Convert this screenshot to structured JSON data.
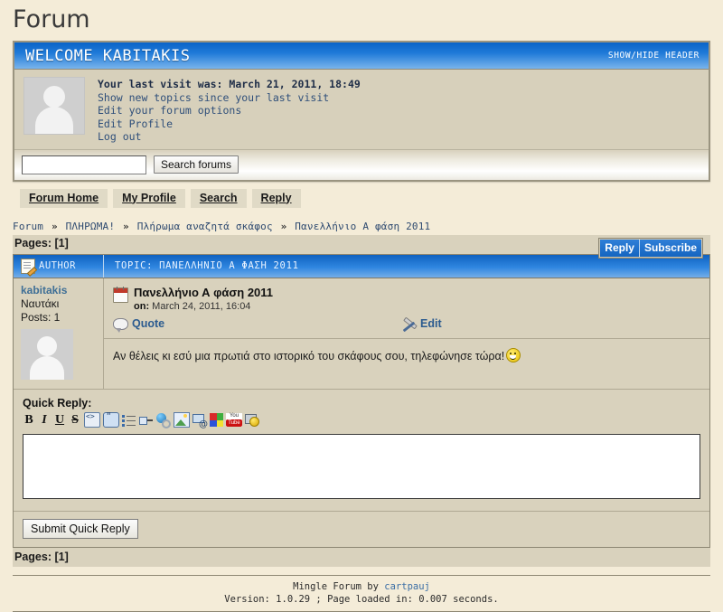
{
  "page": {
    "title": "Forum"
  },
  "welcome": {
    "title": "WELCOME KABITAKIS",
    "show_hide_header": "SHOW/HIDE HEADER",
    "last_visit": "Your last visit was: March 21, 2011, 18:49",
    "links": [
      "Show new topics since your last visit",
      "Edit your forum options",
      "Edit Profile",
      "Log out"
    ],
    "search": {
      "value": "",
      "placeholder": "",
      "button_label": "Search forums"
    }
  },
  "nav": {
    "items": [
      "Forum Home",
      "My Profile",
      "Search",
      "Reply"
    ]
  },
  "breadcrumb": {
    "items": [
      "Forum",
      "ΠΛΗΡΩΜΑ!",
      "Πλήρωμα αναζητά σκάφος",
      "Πανελλήνιο Α φάση 2011"
    ],
    "separator": "»"
  },
  "pages": {
    "label": "Pages: [",
    "current": "1",
    "close": "]"
  },
  "tabs": [
    {
      "label": "Reply"
    },
    {
      "label": "Subscribe"
    }
  ],
  "topic": {
    "author_column_header": "AUTHOR",
    "topic_header": "TOPIC: ΠΑΝΕΛΛΗΝΙΟ Α ΦΑΣΗ 2011"
  },
  "post": {
    "author": {
      "name": "kabitakis",
      "rank": "Ναυτάκι",
      "posts": "Posts: 1"
    },
    "title": "Πανελλήνιο Α φάση 2011",
    "date_label": "on:",
    "date": " March 24, 2011, 16:04",
    "actions": {
      "quote": "Quote",
      "edit": "Edit"
    },
    "body": "Αν θέλεις κι εσύ μια πρωτιά στο ιστορικό του σκάφους σου, τηλεφώνησε τώρα!"
  },
  "quick_reply": {
    "title": "Quick Reply:",
    "toolbar": [
      {
        "name": "bold-icon",
        "glyph": "B"
      },
      {
        "name": "italic-icon",
        "glyph": "I"
      },
      {
        "name": "underline-icon",
        "glyph": "U"
      },
      {
        "name": "strikethrough-icon",
        "glyph": "S"
      },
      {
        "name": "code-icon",
        "glyph": ""
      },
      {
        "name": "quote-icon",
        "glyph": ""
      },
      {
        "name": "list-icon",
        "glyph": ""
      },
      {
        "name": "horizontal-rule-icon",
        "glyph": ""
      },
      {
        "name": "link-icon",
        "glyph": ""
      },
      {
        "name": "image-icon",
        "glyph": ""
      },
      {
        "name": "email-icon",
        "glyph": ""
      },
      {
        "name": "color-palette-icon",
        "glyph": ""
      },
      {
        "name": "youtube-icon",
        "glyph": ""
      },
      {
        "name": "smiley-icon",
        "glyph": ""
      }
    ],
    "youtube_top": "You",
    "youtube_bottom": "Tube",
    "textarea_value": "",
    "textarea_placeholder": "",
    "submit_label": "Submit Quick Reply"
  },
  "footer": {
    "line1_prefix": "Mingle Forum by ",
    "line1_link": "cartpauj",
    "line2": "Version: 1.0.29 ; Page loaded in: 0.007 seconds."
  },
  "colors": {
    "page_bg": "#f4ecd8",
    "panel_bg": "#d9d2bd",
    "header_blue": "#1f7ad8",
    "link_blue": "#2e4a70",
    "accent_blue": "#2b5b8f"
  }
}
